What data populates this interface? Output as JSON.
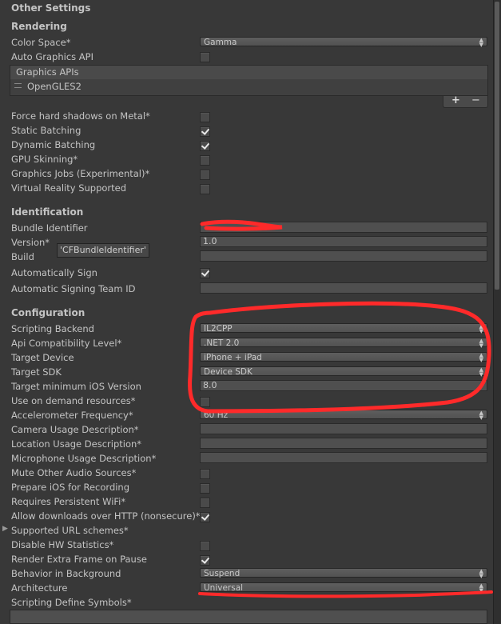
{
  "header": "Other Settings",
  "rendering": {
    "title": "Rendering",
    "color_space_label": "Color Space*",
    "color_space_value": "Gamma",
    "auto_graphics_label": "Auto Graphics API",
    "graphics_apis_header": "Graphics APIs",
    "graphics_api_item": "OpenGLES2",
    "add_label": "+",
    "remove_label": "−",
    "force_hard_shadows_label": "Force hard shadows on Metal*",
    "static_batching_label": "Static Batching",
    "dynamic_batching_label": "Dynamic Batching",
    "gpu_skinning_label": "GPU Skinning*",
    "graphics_jobs_label": "Graphics Jobs (Experimental)*",
    "vr_supported_label": "Virtual Reality Supported"
  },
  "identification": {
    "title": "Identification",
    "bundle_identifier_label": "Bundle Identifier",
    "bundle_identifier_value": "",
    "version_label": "Version*",
    "version_value": "1.0",
    "build_label": "Build",
    "build_value": "",
    "tooltip": "'CFBundleIdentifier'",
    "auto_sign_label": "Automatically Sign",
    "signing_team_label": "Automatic Signing Team ID",
    "signing_team_value": ""
  },
  "configuration": {
    "title": "Configuration",
    "scripting_backend_label": "Scripting Backend",
    "scripting_backend_value": "IL2CPP",
    "api_compat_label": "Api Compatibility Level*",
    "api_compat_value": ".NET 2.0",
    "target_device_label": "Target Device",
    "target_device_value": "iPhone + iPad",
    "target_sdk_label": "Target SDK",
    "target_sdk_value": "Device SDK",
    "min_ios_label": "Target minimum iOS Version",
    "min_ios_value": "8.0",
    "on_demand_label": "Use on demand resources*",
    "accel_freq_label": "Accelerometer Frequency*",
    "accel_freq_value": "60 Hz",
    "camera_usage_label": "Camera Usage Description*",
    "location_usage_label": "Location Usage Description*",
    "microphone_usage_label": "Microphone Usage Description*",
    "mute_audio_label": "Mute Other Audio Sources*",
    "prepare_recording_label": "Prepare iOS for Recording",
    "persistent_wifi_label": "Requires Persistent WiFi*",
    "allow_http_label": "Allow downloads over HTTP (nonsecure)*",
    "url_schemes_label": "Supported URL schemes*",
    "disable_hw_stats_label": "Disable HW Statistics*",
    "render_extra_frame_label": "Render Extra Frame on Pause",
    "behavior_bg_label": "Behavior in Background",
    "behavior_bg_value": "Suspend",
    "architecture_label": "Architecture",
    "architecture_value": "Universal",
    "define_symbols_label": "Scripting Define Symbols*"
  },
  "colors": {
    "background": "#383838",
    "annotation_red": "#ff2a2a"
  }
}
